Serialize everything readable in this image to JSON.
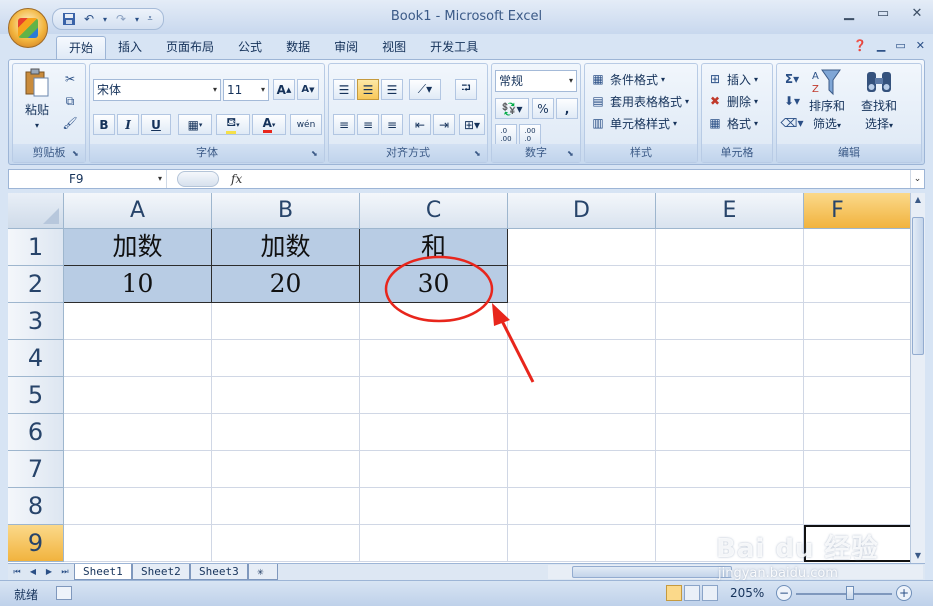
{
  "title": "Book1 - Microsoft Excel",
  "qat": {
    "save_icon": "save-icon",
    "undo_icon": "undo-icon",
    "redo_icon": "redo-icon"
  },
  "tabs": [
    "开始",
    "插入",
    "页面布局",
    "公式",
    "数据",
    "审阅",
    "视图",
    "开发工具"
  ],
  "ribbon": {
    "clipboard": {
      "paste": "粘贴",
      "label": "剪贴板"
    },
    "font": {
      "name": "宋体",
      "size": "11",
      "label": "字体",
      "bold": "B",
      "italic": "I",
      "underline": "U",
      "color_letter": "A",
      "phonetic": "wén"
    },
    "alignment": {
      "label": "对齐方式"
    },
    "number": {
      "format": "常规",
      "percent": "%",
      "comma": ",",
      "inc": ".0←.00",
      "dec": ".00→.0",
      "label": "数字"
    },
    "styles": {
      "conditional": "条件格式",
      "table": "套用表格格式",
      "cell": "单元格样式",
      "label": "样式"
    },
    "cells": {
      "insert": "插入",
      "delete": "删除",
      "format": "格式",
      "label": "单元格"
    },
    "editing": {
      "sort": "排序和",
      "sort2": "筛选",
      "find": "查找和",
      "find2": "选择",
      "label": "编辑"
    }
  },
  "formula_bar": {
    "name_box": "F9",
    "fx": "fx",
    "value": ""
  },
  "columns": [
    "A",
    "B",
    "C",
    "D",
    "E",
    "F"
  ],
  "rows": [
    "1",
    "2",
    "3",
    "4",
    "5",
    "6",
    "7",
    "8",
    "9"
  ],
  "cells": {
    "A1": "加数",
    "B1": "加数",
    "C1": "和",
    "A2": "10",
    "B2": "20",
    "C2": "30"
  },
  "selected_cell": "F9",
  "sheets": [
    "Sheet1",
    "Sheet2",
    "Sheet3"
  ],
  "status": {
    "ready": "就绪",
    "zoom": "205%"
  },
  "watermark": {
    "main": "Bai du 经验",
    "sub": "jingyan.baidu.com"
  },
  "colors": {
    "fill": "#b8cce4",
    "annotation": "#e8261c",
    "selected_header": "#f1b33e"
  }
}
